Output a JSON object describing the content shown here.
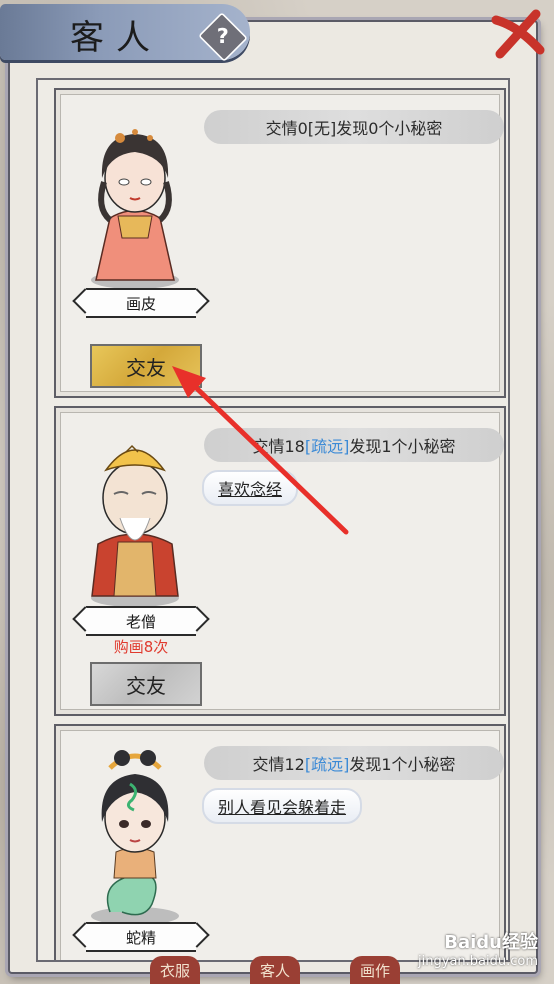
{
  "header": {
    "title": "客人",
    "help_icon": "question-icon",
    "close_icon": "close-brush-icon"
  },
  "guests": [
    {
      "affinity_label": "交情0",
      "relation": "[无]",
      "relation_color": "#2b2b2b",
      "secrets_text": " 发现0个小秘密",
      "secret_tag": "",
      "name": "画皮",
      "buy_count": "",
      "button_label": "交友",
      "button_style": "gold"
    },
    {
      "affinity_label": "交情18",
      "relation": "[疏远]",
      "relation_color": "#3b8ad6",
      "secrets_text": " 发现1个小秘密",
      "secret_tag": "喜欢念经",
      "name": "老僧",
      "buy_count": "购画8次",
      "button_label": "交友",
      "button_style": "grey"
    },
    {
      "affinity_label": "交情12",
      "relation": "[疏远]",
      "relation_color": "#3b8ad6",
      "secrets_text": " 发现1个小秘密",
      "secret_tag": "别人看见会躲着走",
      "name": "蛇精",
      "buy_count": "",
      "button_label": "",
      "button_style": ""
    }
  ],
  "bottom_nav": [
    "衣服",
    "客人",
    "画作"
  ],
  "watermark": {
    "brand": "Baidu经验",
    "url": "jingyan.baidu.com"
  },
  "colors": {
    "accent_red": "#e03a2e",
    "relation_blue": "#3b8ad6",
    "button_gold": "#d4a83a",
    "arrow_red": "#e8302a"
  }
}
